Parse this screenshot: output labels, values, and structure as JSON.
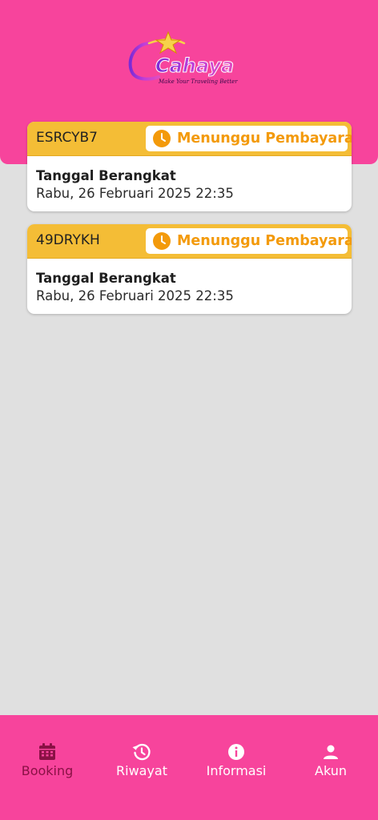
{
  "app": {
    "logo_text": "Cahaya",
    "logo_tagline": "Make Your Traveling Better"
  },
  "colors": {
    "primary": "#f7449c",
    "card_header": "#f4bd36",
    "status": "#f39a0b",
    "active_nav": "#8a1145",
    "background": "#e0e0e0"
  },
  "bookings": [
    {
      "code": "ESRCYB7",
      "status": "Menunggu Pembayaran",
      "status_icon": "clock-icon",
      "date_label": "Tanggal Berangkat",
      "date_value": "Rabu, 26 Februari 2025 22:35"
    },
    {
      "code": "49DRYKH",
      "status": "Menunggu Pembayaran",
      "status_icon": "clock-icon",
      "date_label": "Tanggal Berangkat",
      "date_value": "Rabu, 26 Februari 2025 22:35"
    }
  ],
  "nav": {
    "items": [
      {
        "label": "Booking",
        "icon": "calendar-icon",
        "active": true
      },
      {
        "label": "Riwayat",
        "icon": "history-icon",
        "active": false
      },
      {
        "label": "Informasi",
        "icon": "info-icon",
        "active": false
      },
      {
        "label": "Akun",
        "icon": "user-icon",
        "active": false
      }
    ]
  }
}
